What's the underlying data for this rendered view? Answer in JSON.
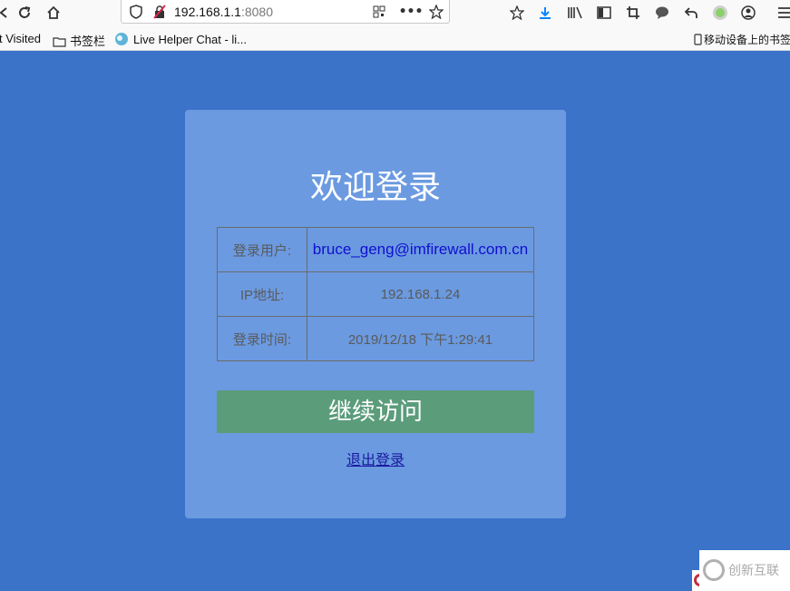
{
  "browser": {
    "url_host": "192.168.1.1",
    "url_port": ":8080",
    "bookmarks": [
      {
        "label": "t Visited",
        "icon": "none"
      },
      {
        "label": "书签栏",
        "icon": "folder-icon"
      },
      {
        "label": "Live Helper Chat - li...",
        "icon": "chat-bubble-icon"
      }
    ],
    "mobile_bookmarks": "移动设备上的书签"
  },
  "login": {
    "title": "欢迎登录",
    "rows": [
      {
        "label": "登录用户:",
        "value": "bruce_geng@imfirewall.com.cn"
      },
      {
        "label": "IP地址:",
        "value": "192.168.1.24"
      },
      {
        "label": "登录时间:",
        "value": "2019/12/18 下午1:29:41"
      }
    ],
    "continue_label": "继续访问",
    "logout_label": "退出登录"
  },
  "watermark": {
    "text": "创新互联"
  },
  "colors": {
    "page_bg": "#3a73c8",
    "card_bg": "#6b9ae0",
    "continue_bg": "#5b9c7b",
    "link": "#1a1aa0",
    "user_value": "#1010d0"
  }
}
